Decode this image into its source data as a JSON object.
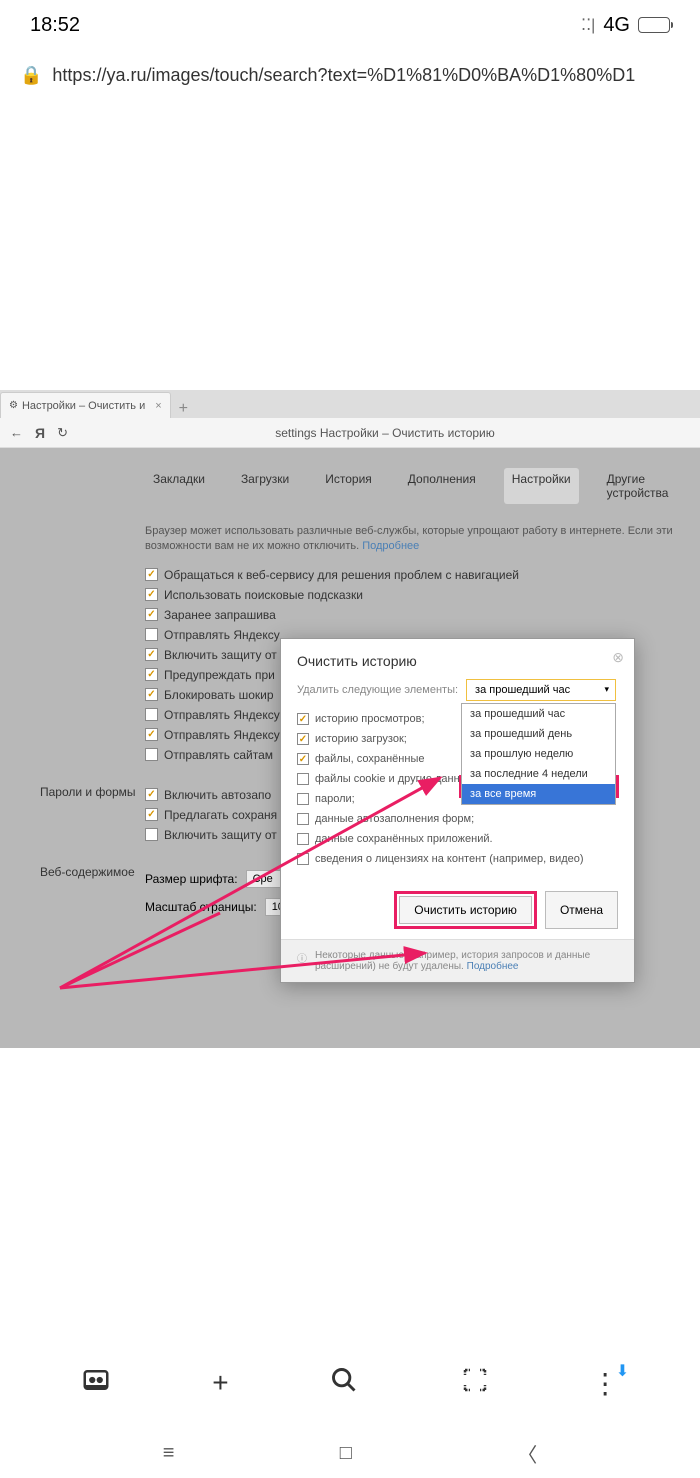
{
  "status": {
    "time": "18:52",
    "network": "4G"
  },
  "url": "https://ya.ru/images/touch/search?text=%D1%81%D0%BA%D1%80%D1",
  "browser": {
    "tab_title": "Настройки – Очистить и",
    "address": "settings   Настройки – Очистить историю"
  },
  "menu": {
    "bookmarks": "Закладки",
    "downloads": "Загрузки",
    "history": "История",
    "addons": "Дополнения",
    "settings": "Настройки",
    "devices": "Другие устройства"
  },
  "info": {
    "text": "Браузер может использовать различные веб-службы, которые упрощают работу в интернете. Если эти возможности вам не их можно отключить.",
    "more": "Подробнее"
  },
  "settings_checks": {
    "c1": "Обращаться к веб-сервису для решения проблем с навигацией",
    "c2": "Использовать поисковые подсказки",
    "c3": "Заранее запрашива",
    "c4": "Отправлять Яндексу",
    "c5": "Включить защиту от",
    "c6": "Предупреждать при",
    "c7": "Блокировать шокир",
    "c8": "Отправлять Яндексу",
    "c9": "Отправлять Яндексу",
    "c10": "Отправлять сайтам",
    "c11": "Включить автозапо",
    "c12": "Предлагать сохраня",
    "c13": "Включить защиту от"
  },
  "section": {
    "passwords": "Пароли и формы",
    "web": "Веб-содержимое"
  },
  "web": {
    "font_label": "Размер шрифта:",
    "font_value": "Сре",
    "zoom_label": "Масштаб страницы:",
    "zoom_value": "100%"
  },
  "dialog": {
    "title": "Очистить историю",
    "label": "Удалить следующие элементы:",
    "selected": "за прошедший час",
    "options": {
      "o1": "за прошедший час",
      "o2": "за прошедший день",
      "o3": "за прошлую неделю",
      "o4": "за последние 4 недели",
      "o5": "за все время"
    },
    "checks": {
      "d1": "историю просмотров;",
      "d2": "историю загрузок;",
      "d3": "файлы, сохранённые",
      "d4": "файлы cookie и другие данные сайтов и модулей;",
      "d5": "пароли;",
      "d6": "данные автозаполнения форм;",
      "d7": "данные сохранённых приложений.",
      "d8": "сведения о лицензиях на контент (например, видео)"
    },
    "btn_clear": "Очистить историю",
    "btn_cancel": "Отмена",
    "footer": "Некоторые данные (например, история запросов и данные расширений) не будут удалены.",
    "footer_more": "Подробнее"
  }
}
